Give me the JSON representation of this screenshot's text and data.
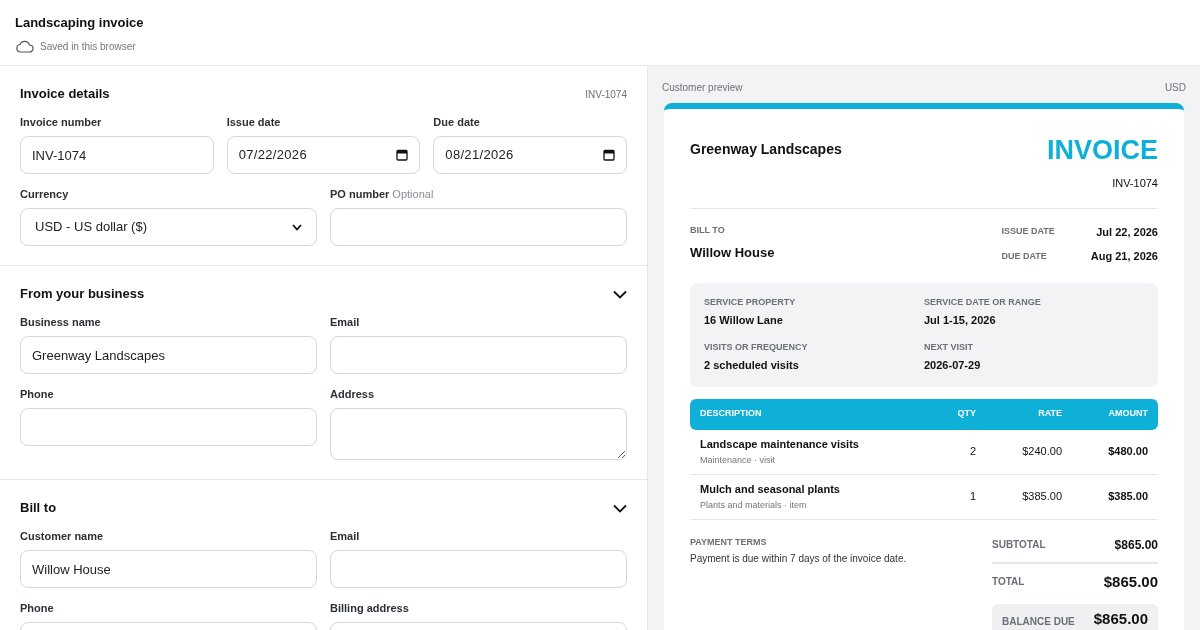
{
  "header": {
    "title": "Landscaping invoice",
    "status": "Saved in this browser"
  },
  "form_sections": [
    {
      "title": "Invoice details",
      "tag": "INV-1074",
      "rows": [
        [
          {
            "label": "Invoice number",
            "kind": "text",
            "value": "INV-1074"
          },
          {
            "label": "Issue date",
            "kind": "date",
            "value": "07/22/2026"
          },
          {
            "label": "Due date",
            "kind": "date",
            "value": "08/21/2026"
          }
        ],
        [
          {
            "label": "Currency",
            "kind": "select",
            "value": "USD - US dollar ($)"
          },
          {
            "label": "PO number",
            "hint": "Optional",
            "kind": "text"
          }
        ]
      ]
    },
    {
      "title": "From your business",
      "expanded": true,
      "rows": [
        [
          {
            "label": "Business name",
            "kind": "text",
            "value": "Greenway Landscapes"
          },
          {
            "label": "Email",
            "kind": "text"
          }
        ],
        [
          {
            "label": "Phone",
            "kind": "text"
          },
          {
            "label": "Address",
            "kind": "textarea"
          }
        ]
      ]
    },
    {
      "title": "Bill to",
      "expanded": true,
      "rows": [
        [
          {
            "label": "Customer name",
            "kind": "text",
            "value": "Willow House"
          },
          {
            "label": "Email",
            "kind": "text"
          }
        ],
        [
          {
            "label": "Phone",
            "kind": "text"
          },
          {
            "label": "Billing address",
            "kind": "textarea"
          }
        ]
      ]
    }
  ],
  "preview": {
    "label": "Customer preview",
    "currency": "USD",
    "card": {
      "business": "Greenway Landscapes",
      "doc_title": "INVOICE",
      "number": "INV-1074",
      "bill_to_label": "BILL TO",
      "customer": "Willow House",
      "dates": [
        {
          "label": "ISSUE DATE",
          "value": "Jul 22, 2026"
        },
        {
          "label": "DUE DATE",
          "value": "Aug 21, 2026"
        }
      ],
      "service": [
        {
          "label": "SERVICE PROPERTY",
          "value": "16 Willow Lane"
        },
        {
          "label": "SERVICE DATE OR RANGE",
          "value": "Jul 1-15, 2026"
        },
        {
          "label": "VISITS OR FREQUENCY",
          "value": "2 scheduled visits"
        },
        {
          "label": "NEXT VISIT",
          "value": "2026-07-29"
        }
      ],
      "table": {
        "columns": [
          "DESCRIPTION",
          "QTY",
          "RATE",
          "AMOUNT"
        ],
        "rows": [
          {
            "description": "Landscape maintenance visits",
            "detail": "Maintenance · visit",
            "qty": "2",
            "rate": "$240.00",
            "amount": "$480.00"
          },
          {
            "description": "Mulch and seasonal plants",
            "detail": "Plants and materials · item",
            "qty": "1",
            "rate": "$385.00",
            "amount": "$385.00"
          }
        ]
      },
      "terms_label": "PAYMENT TERMS",
      "terms": "Payment is due within 7 days of the invoice date.",
      "totals": [
        {
          "kind": "subtotal",
          "label": "SUBTOTAL",
          "value": "$865.00"
        },
        {
          "kind": "total",
          "label": "TOTAL",
          "value": "$865.00"
        },
        {
          "kind": "balance",
          "label": "BALANCE DUE",
          "value": "$865.00"
        }
      ]
    }
  }
}
